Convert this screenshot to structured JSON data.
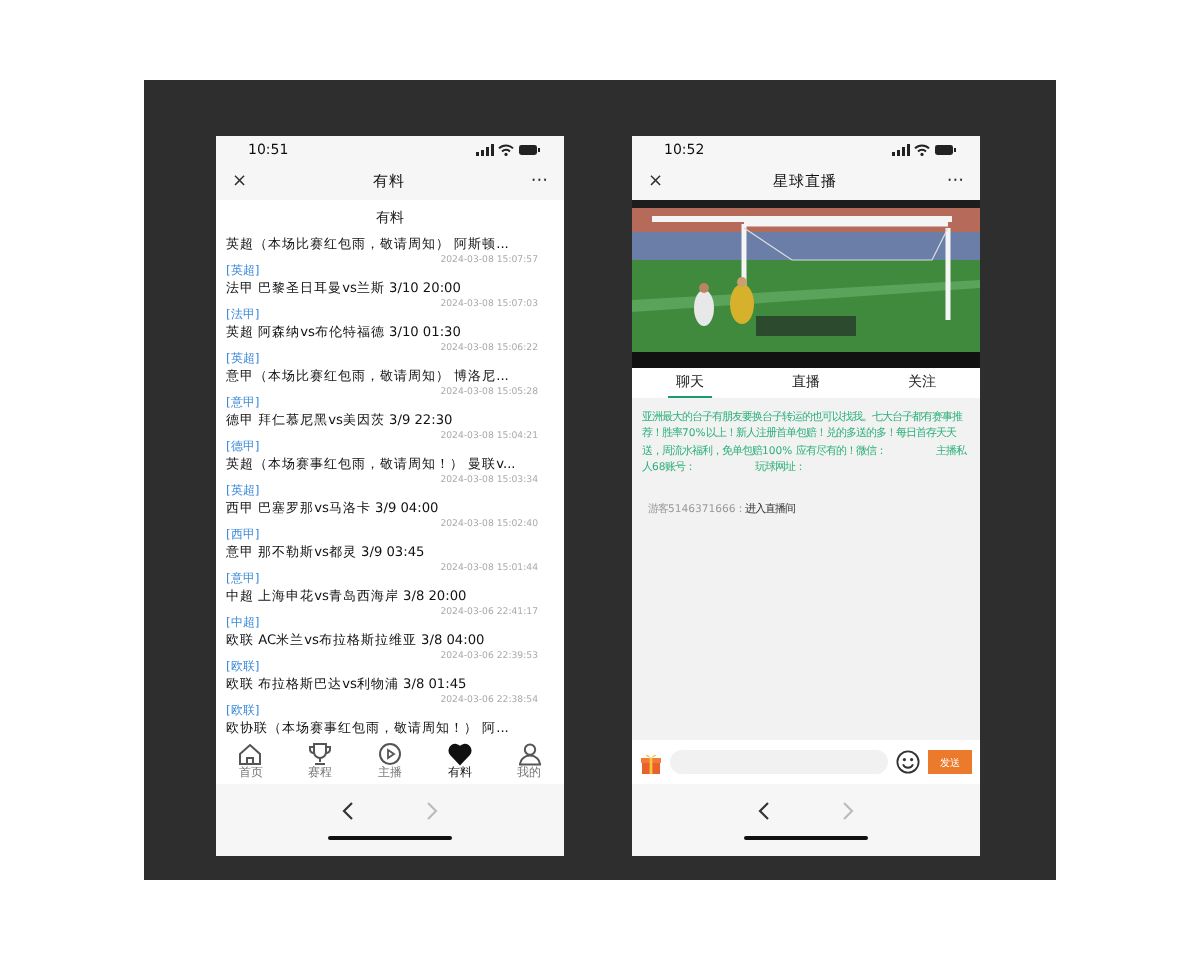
{
  "left_phone": {
    "status_time": "10:51",
    "title": "有料",
    "close": "×",
    "more": "···",
    "section_title": "有料",
    "posts": [
      {
        "title": "英超（本场比赛红包雨，敬请周知） 阿斯顿...",
        "time": "2024-03-08 15:07:57",
        "tag": "[英超]"
      },
      {
        "title": "法甲 巴黎圣日耳曼vs兰斯 3/10 20:00",
        "time": "2024-03-08 15:07:03",
        "tag": "[法甲]"
      },
      {
        "title": "英超 阿森纳vs布伦特福德 3/10 01:30",
        "time": "2024-03-08 15:06:22",
        "tag": "[英超]"
      },
      {
        "title": "意甲（本场比赛红包雨，敬请周知） 博洛尼...",
        "time": "2024-03-08 15:05:28",
        "tag": "[意甲]"
      },
      {
        "title": "德甲 拜仁慕尼黑vs美因茨 3/9 22:30",
        "time": "2024-03-08 15:04:21",
        "tag": "[德甲]"
      },
      {
        "title": "英超（本场赛事红包雨，敬请周知！） 曼联v...",
        "time": "2024-03-08 15:03:34",
        "tag": "[英超]"
      },
      {
        "title": "西甲 巴塞罗那vs马洛卡 3/9 04:00",
        "time": "2024-03-08 15:02:40",
        "tag": "[西甲]"
      },
      {
        "title": "意甲 那不勒斯vs都灵 3/9 03:45",
        "time": "2024-03-08 15:01:44",
        "tag": "[意甲]"
      },
      {
        "title": "中超 上海申花vs青岛西海岸 3/8 20:00",
        "time": "2024-03-06 22:41:17",
        "tag": "[中超]"
      },
      {
        "title": "欧联 AC米兰vs布拉格斯拉维亚 3/8 04:00",
        "time": "2024-03-06 22:39:53",
        "tag": "[欧联]"
      },
      {
        "title": "欧联 布拉格斯巴达vs利物浦 3/8 01:45",
        "time": "2024-03-06 22:38:54",
        "tag": "[欧联]"
      },
      {
        "title": "欧协联（本场赛事红包雨，敬请周知！） 阿..."
      }
    ],
    "tab_bar": [
      {
        "label": "首页",
        "selected": false
      },
      {
        "label": "赛程",
        "selected": false
      },
      {
        "label": "主播",
        "selected": false
      },
      {
        "label": "有料",
        "selected": true
      },
      {
        "label": "我的",
        "selected": false
      }
    ]
  },
  "right_phone": {
    "status_time": "10:52",
    "title": "星球直播",
    "close": "×",
    "more": "···",
    "tabs": [
      {
        "label": "聊天",
        "selected": true
      },
      {
        "label": "直播",
        "selected": false
      },
      {
        "label": "关注",
        "selected": false
      }
    ],
    "messages": [
      {
        "kind": "notice",
        "text": "亚洲最大的台子有朋友要换台子转运的也可以找我。七大台子都有赛事推荐！胜率70%以上！新人注册首单包赔！兑的多送的多！每日首存天天送，周流水福利，免单包赔100% 应有尽有的！微信：　　　　　主播私人68账号：　　　　　　玩球网址："
      },
      {
        "kind": "join",
        "user": "游客5146371666：",
        "text": "进入直播间"
      }
    ],
    "send_button": "发送"
  }
}
